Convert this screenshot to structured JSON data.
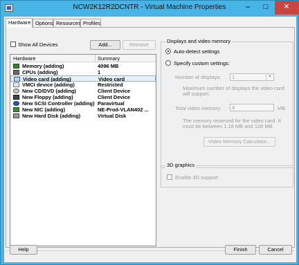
{
  "window": {
    "title": "NCW2K12R2DCNTR - Virtual Machine Properties",
    "minimize_glyph": "–",
    "maximize_glyph": "□",
    "close_glyph": "✕"
  },
  "tabs": [
    {
      "label": "Hardware",
      "active": true
    },
    {
      "label": "Options",
      "active": false
    },
    {
      "label": "Resources",
      "active": false
    },
    {
      "label": "Profiles",
      "active": false
    }
  ],
  "hardware": {
    "show_all_devices_label": "Show All Devices",
    "add_button": "Add...",
    "remove_button": "Remove",
    "columns": {
      "hardware": "Hardware",
      "summary": "Summary"
    },
    "rows": [
      {
        "name": "Memory (adding)",
        "summary": "4096 MB",
        "icon": "memory-icon"
      },
      {
        "name": "CPUs (adding)",
        "summary": "1",
        "icon": "cpu-icon"
      },
      {
        "name": "Video card  (adding)",
        "summary": "Video card",
        "icon": "video-card-icon",
        "selected": true
      },
      {
        "name": "VMCI device (adding)",
        "summary": "Restricted",
        "icon": "vmci-device-icon"
      },
      {
        "name": "New CD/DVD (adding)",
        "summary": "Client Device",
        "icon": "cd-dvd-icon"
      },
      {
        "name": "New Floppy (adding)",
        "summary": "Client Device",
        "icon": "floppy-icon"
      },
      {
        "name": "New SCSI Controller (adding)",
        "summary": "Paravirtual",
        "icon": "scsi-controller-icon"
      },
      {
        "name": "New NIC (adding)",
        "summary": "NE-Prod-VLAN402 ...",
        "icon": "nic-icon"
      },
      {
        "name": "New Hard Disk (adding)",
        "summary": "Virtual Disk",
        "icon": "hard-disk-icon"
      }
    ]
  },
  "display": {
    "group_title": "Displays and video memory",
    "auto_detect_label": "Auto-detect settings",
    "custom_label": "Specify custom settings:",
    "num_displays_label": "Number of displays:",
    "num_displays_value": "1",
    "max_displays_note": "Maximum number of displays the video card will support.",
    "total_memory_label": "Total video memory:",
    "total_memory_value": "4",
    "total_memory_unit": "MB",
    "memory_note": "The memory reserved for the video card. It must be between 1.18 MB and 128 MB.",
    "calculator_button": "Video Memory Calculator..."
  },
  "graphics3d": {
    "group_title": "3D graphics",
    "enable_label": "Enable 3D support"
  },
  "footer": {
    "help_button": "Help",
    "finish_button": "Finish",
    "cancel_button": "Cancel"
  }
}
